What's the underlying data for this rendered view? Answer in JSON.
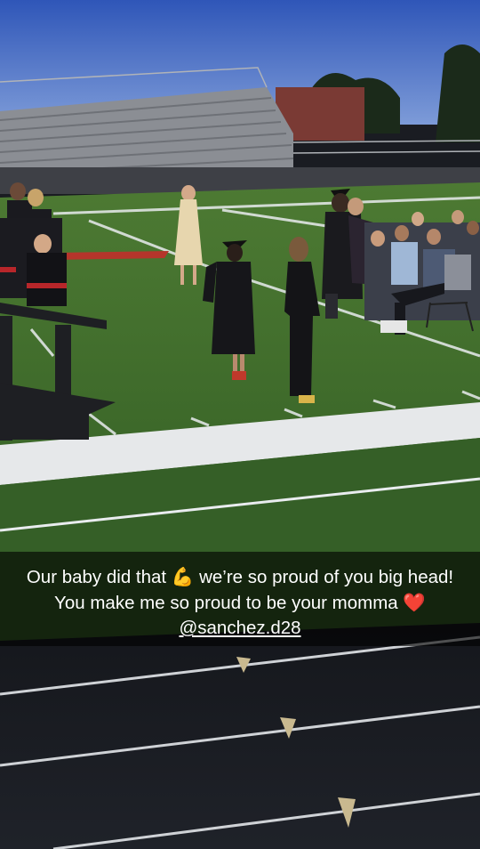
{
  "photo": {
    "caption": {
      "text_1": "Our baby did that",
      "emoji_1": "💪",
      "text_2": "we’re so proud of you big head! You make me so proud to be your momma",
      "emoji_2": "❤️",
      "mention": "@sanchez.d28"
    }
  }
}
